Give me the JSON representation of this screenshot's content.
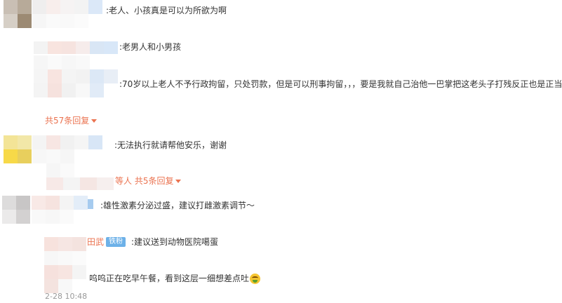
{
  "comments": [
    {
      "id": "c1",
      "text": ":老人、小孩真是可以为所欲为啊"
    },
    {
      "id": "r1",
      "text": ":老男人和小男孩"
    },
    {
      "id": "r2",
      "text": ":70岁以上老人不予行政拘留，只处罚款，但是可以刑事拘留，，，要是我就自己治他一巴掌把这老头子打残反正也是正当"
    },
    {
      "id": "more1",
      "text": "共57条回复"
    },
    {
      "id": "c2",
      "text": ":无法执行就请帮他安乐，谢谢"
    },
    {
      "id": "more2",
      "text": "等人 共5条回复"
    },
    {
      "id": "c3",
      "text": ":雄性激素分泌过盛，建议打雌激素调节～"
    },
    {
      "id": "r3_name",
      "text": "田武"
    },
    {
      "id": "r3_badge",
      "text": "铁粉"
    },
    {
      "id": "r3",
      "text": ":建议送到动物医院噶蛋"
    },
    {
      "id": "r4",
      "text": "呜呜正在吃早午餐，看到这层一细想差点吐"
    },
    {
      "id": "r4_time",
      "text": "2-28 10:48"
    }
  ],
  "colors": {
    "link": "#eb7350",
    "badge": "#6db1e8",
    "text": "#333333"
  },
  "icons": {
    "chevron": "chevron-down-icon",
    "emoji": "vomit-emoji-icon"
  }
}
